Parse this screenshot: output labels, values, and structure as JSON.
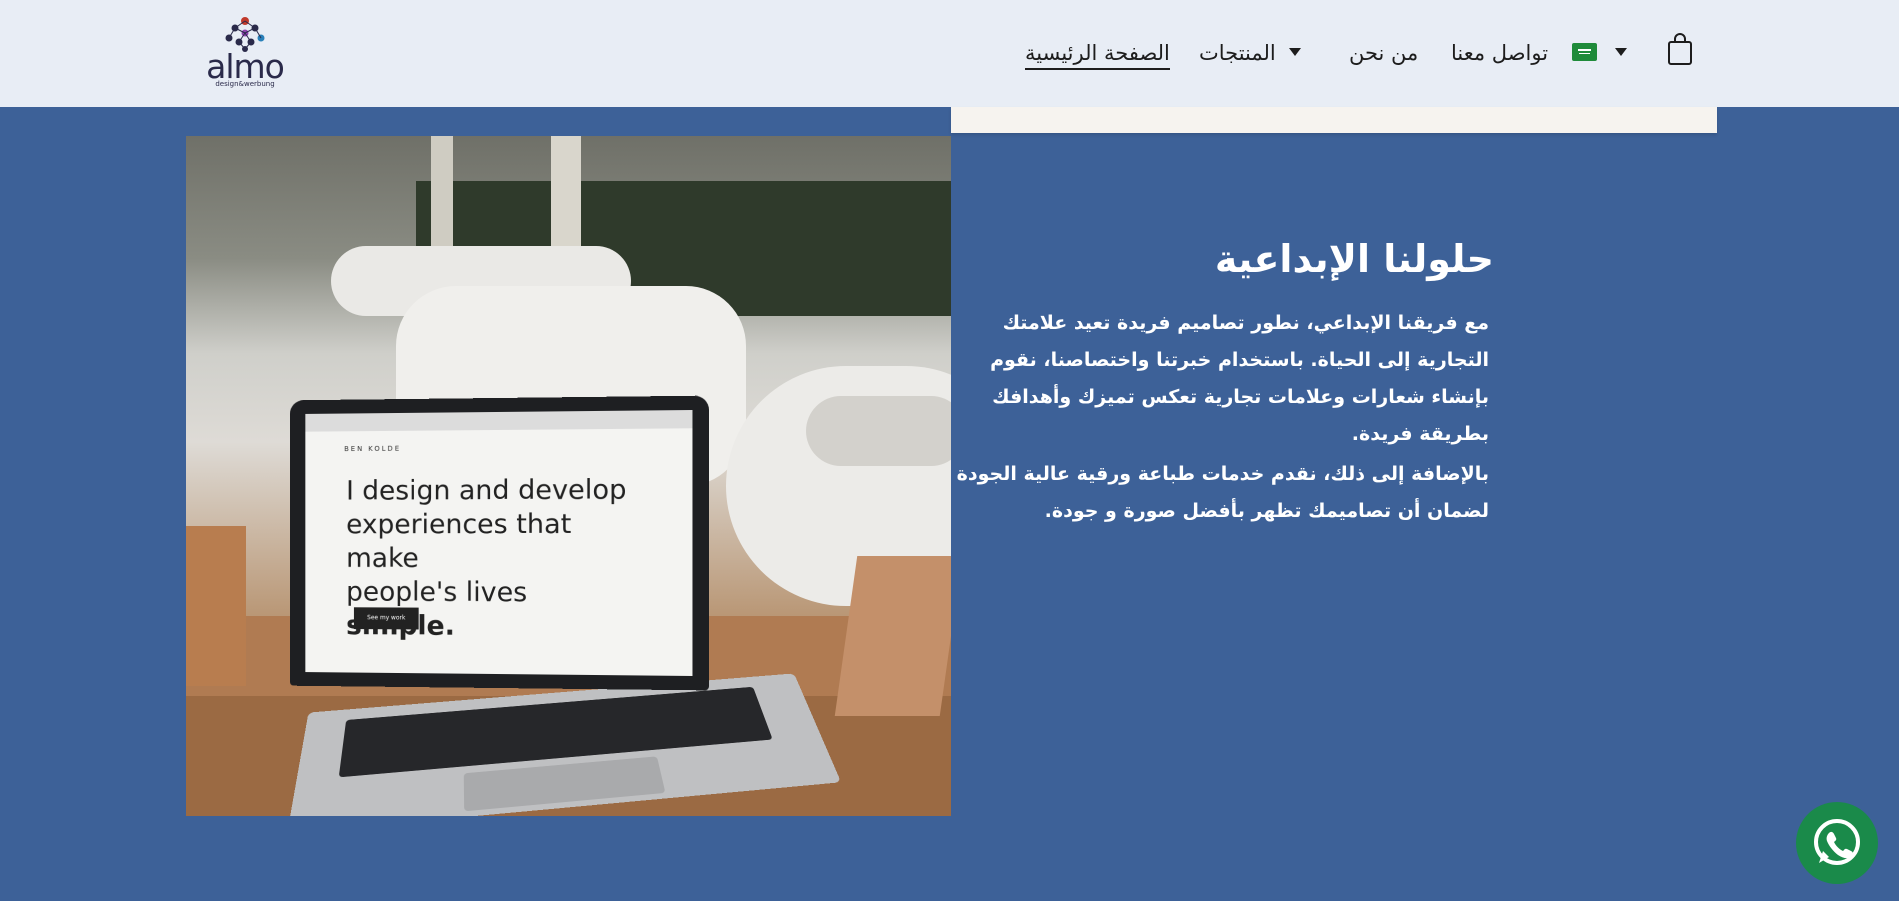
{
  "header": {
    "logo": {
      "word": "almo",
      "tagline": "design&werbung"
    },
    "nav": {
      "home": "الصفحة الرئيسية",
      "products": "المنتجات",
      "about": "من نحن",
      "contact": "تواصل معنا"
    },
    "language_flag": "flag-icon",
    "cart_icon": "shopping-bag-icon"
  },
  "section": {
    "title": "حلولنا الإبداعية",
    "paragraph_1": "مع فريقنا الإبداعي، نطور تصاميم فريدة تعيد علامتك التجارية إلى الحياة. باستخدام خبرتنا واختصاصنا، نقوم بإنشاء شعارات وعلامات تجارية تعكس تميزك وأهدافك بطريقة فريدة.",
    "paragraph_2": "بالإضافة إلى ذلك، نقدم خدمات طباعة ورقية عالية الجودة لضمان أن تصاميمك تظهر بأفضل صورة و جودة."
  },
  "photo": {
    "site_name": "BEN KOLDE",
    "hero_line_1": "I design and develop",
    "hero_line_2": "experiences that make",
    "hero_line_3": "people's lives",
    "hero_emphasis": "simple.",
    "hero_button": "See my work"
  },
  "whatsapp_icon": "whatsapp-icon",
  "colors": {
    "background": "#3d6198",
    "header": "#e8edf5",
    "whatsapp": "#1a8a4a"
  }
}
